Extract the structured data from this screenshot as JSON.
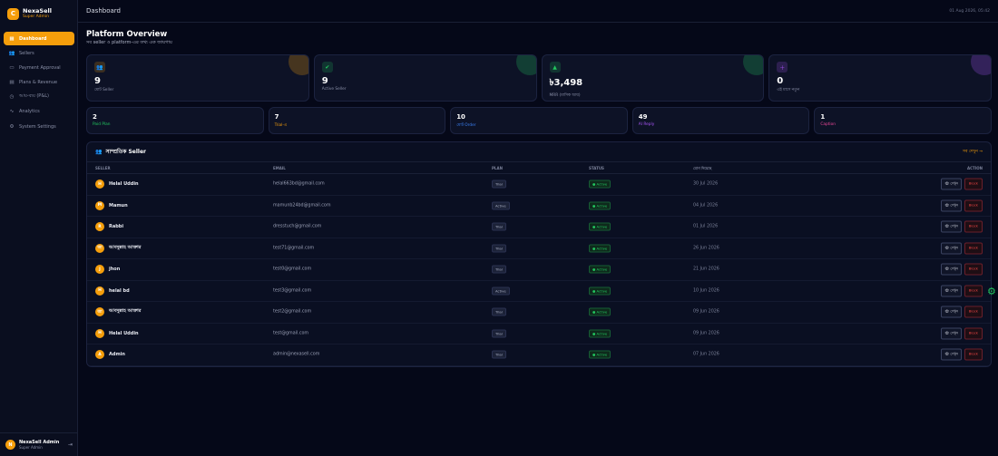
{
  "brand": {
    "logo": "C",
    "name": "NexaSell",
    "role": "Super Admin"
  },
  "sidebar": {
    "items": [
      {
        "icon": "▦",
        "label": "Dashboard",
        "active": true
      },
      {
        "icon": "👥",
        "label": "Sellers",
        "active": false
      },
      {
        "icon": "▭",
        "label": "Payment Approval",
        "active": false
      },
      {
        "icon": "▤",
        "label": "Plans & Revenue",
        "active": false
      },
      {
        "icon": "◷",
        "label": "আয়-ব্যয় (P&L)",
        "active": false
      },
      {
        "icon": "∿",
        "label": "Analytics",
        "active": false
      },
      {
        "icon": "⚙",
        "label": "System Settings",
        "active": false
      }
    ],
    "user": {
      "initial": "N",
      "name": "NexaSell Admin",
      "role": "Super Admin",
      "logout_icon": "⇥"
    }
  },
  "topbar": {
    "title": "Dashboard",
    "date": "01 Aug 2026, 05:42"
  },
  "overview": {
    "title": "Platform Overview",
    "subtitle": "সব seller ও platform-এর তথ্য এক জায়গায়"
  },
  "stats": [
    {
      "icon": "👥",
      "value": "9",
      "label": "মোট Seller",
      "color": "#f59e0b"
    },
    {
      "icon": "✔",
      "value": "9",
      "label": "Active Seller",
      "color": "#22c55e"
    },
    {
      "icon": "▲",
      "value": "৳3,498",
      "label": "MRR (মাসিক আয়)",
      "color": "#22c55e"
    },
    {
      "icon": "＋",
      "value": "0",
      "label": "এই মাসে নতুন",
      "color": "#a855f7"
    }
  ],
  "mini_stats": [
    {
      "value": "2",
      "label": "Paid Plan",
      "color": "#22c55e"
    },
    {
      "value": "7",
      "label": "Trial-এ",
      "color": "#f59e0b"
    },
    {
      "value": "10",
      "label": "মোট Order",
      "color": "#3b82f6"
    },
    {
      "value": "49",
      "label": "AI Reply",
      "color": "#a855f7"
    },
    {
      "value": "1",
      "label": "Caption",
      "color": "#ec4899"
    }
  ],
  "sellers_table": {
    "title": "সাম্প্রতিক Seller",
    "link": "সব দেখুন →",
    "columns": [
      "SELLER",
      "EMAIL",
      "PLAN",
      "STATUS",
      "যোগ দিয়েছে",
      "ACTION"
    ],
    "view_label": "👁 দেখুন",
    "block_label": "Block",
    "rows": [
      {
        "initial": "H",
        "name": "Helal Uddin",
        "email": "helal663bd@gmail.com",
        "plan": "Trial",
        "status": "● Active",
        "date": "30 Jul 2026"
      },
      {
        "initial": "M",
        "name": "Mamun",
        "email": "mamunb24bd@gmail.com",
        "plan": "Active",
        "status": "● Active",
        "date": "04 Jul 2026"
      },
      {
        "initial": "R",
        "name": "Rabbi",
        "email": "dresstuch@gmail.com",
        "plan": "Trial",
        "status": "● Active",
        "date": "01 Jul 2026"
      },
      {
        "initial": "আ",
        "name": "আবদুল্লাহ আক্তার",
        "email": "test71@gmail.com",
        "plan": "Trial",
        "status": "● Active",
        "date": "26 Jun 2026"
      },
      {
        "initial": "J",
        "name": "jhon",
        "email": "test0@gmail.com",
        "plan": "Trial",
        "status": "● Active",
        "date": "21 Jun 2026"
      },
      {
        "initial": "H",
        "name": "helal bd",
        "email": "test3@gmail.com",
        "plan": "Active",
        "status": "● Active",
        "date": "10 Jun 2026"
      },
      {
        "initial": "আ",
        "name": "আবদুল্লাহ আক্তার",
        "email": "test2@gmail.com",
        "plan": "Trial",
        "status": "● Active",
        "date": "09 Jun 2026"
      },
      {
        "initial": "H",
        "name": "Helal Uddin",
        "email": "test@gmail.com",
        "plan": "Trial",
        "status": "● Active",
        "date": "09 Jun 2026"
      },
      {
        "initial": "A",
        "name": "Admin",
        "email": "admin@nexasell.com",
        "plan": "Trial",
        "status": "● Active",
        "date": "07 Jun 2026"
      }
    ]
  },
  "floating_icon": "⚙"
}
